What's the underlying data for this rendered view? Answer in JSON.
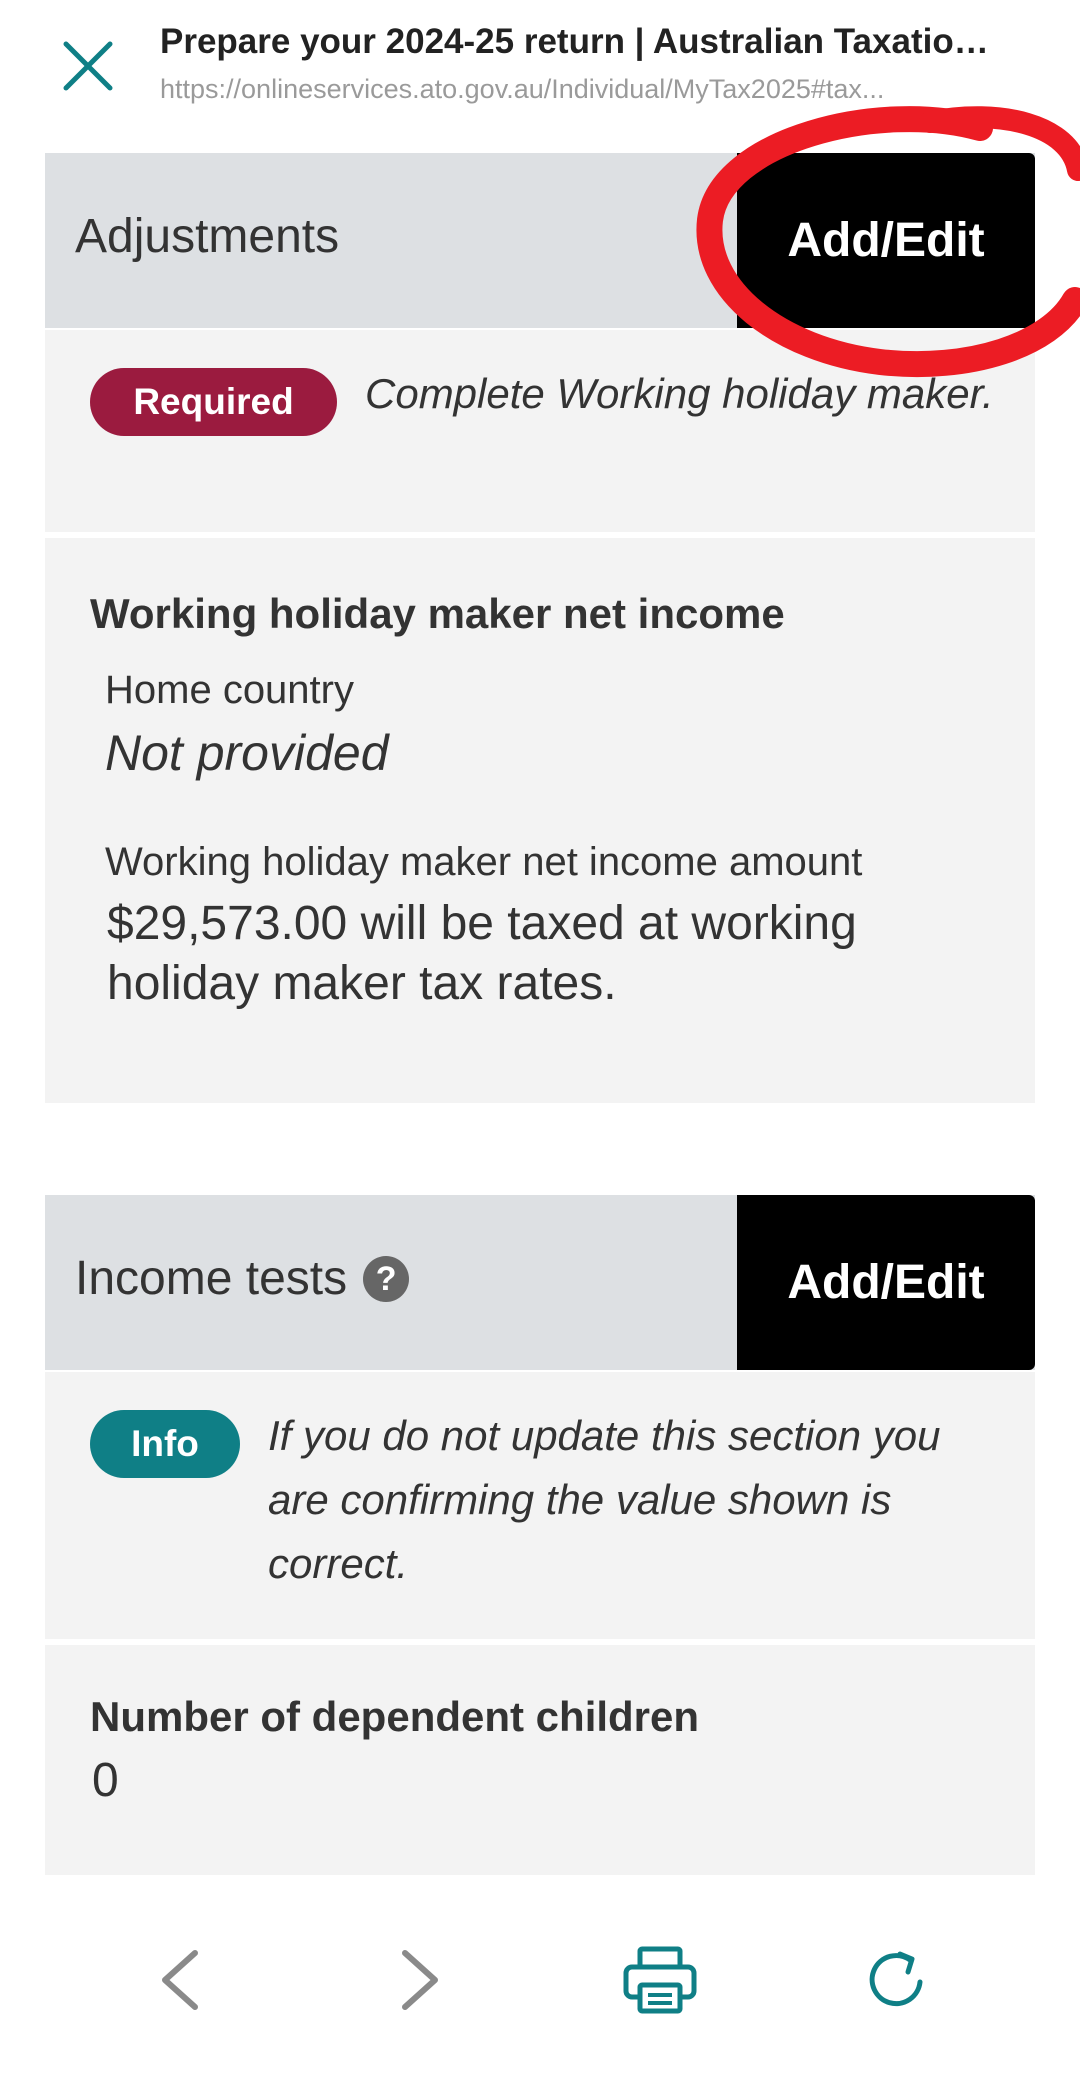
{
  "header": {
    "title": "Prepare your 2024-25 return | Australian Taxation ...",
    "url": "https://onlineservices.ato.gov.au/Individual/MyTax2025#tax..."
  },
  "adjustments": {
    "title": "Adjustments",
    "add_edit_label": "Add/Edit",
    "notice_badge": "Required",
    "notice_text": "Complete Working holiday maker.",
    "section_heading": "Working holiday maker net income",
    "home_country_label": "Home country",
    "home_country_value": "Not provided",
    "amount_label": "Working holiday maker net income amount",
    "amount_text": "$29,573.00 will be taxed at working holiday maker tax rates."
  },
  "income_tests": {
    "title": "Income tests",
    "add_edit_label": "Add/Edit",
    "notice_badge": "Info",
    "notice_text": "If you do not update this section you are confirming the value shown is correct.",
    "dependents_label": "Number of dependent children",
    "dependents_value": "0"
  },
  "colors": {
    "accent_teal": "#0f7f86",
    "required_badge": "#9b1b3f",
    "annotation_red": "#ec1c24"
  },
  "icons": {
    "close": "close-icon",
    "help": "help-icon",
    "back": "chevron-left-icon",
    "forward": "chevron-right-icon",
    "print": "printer-icon",
    "refresh": "refresh-icon"
  }
}
